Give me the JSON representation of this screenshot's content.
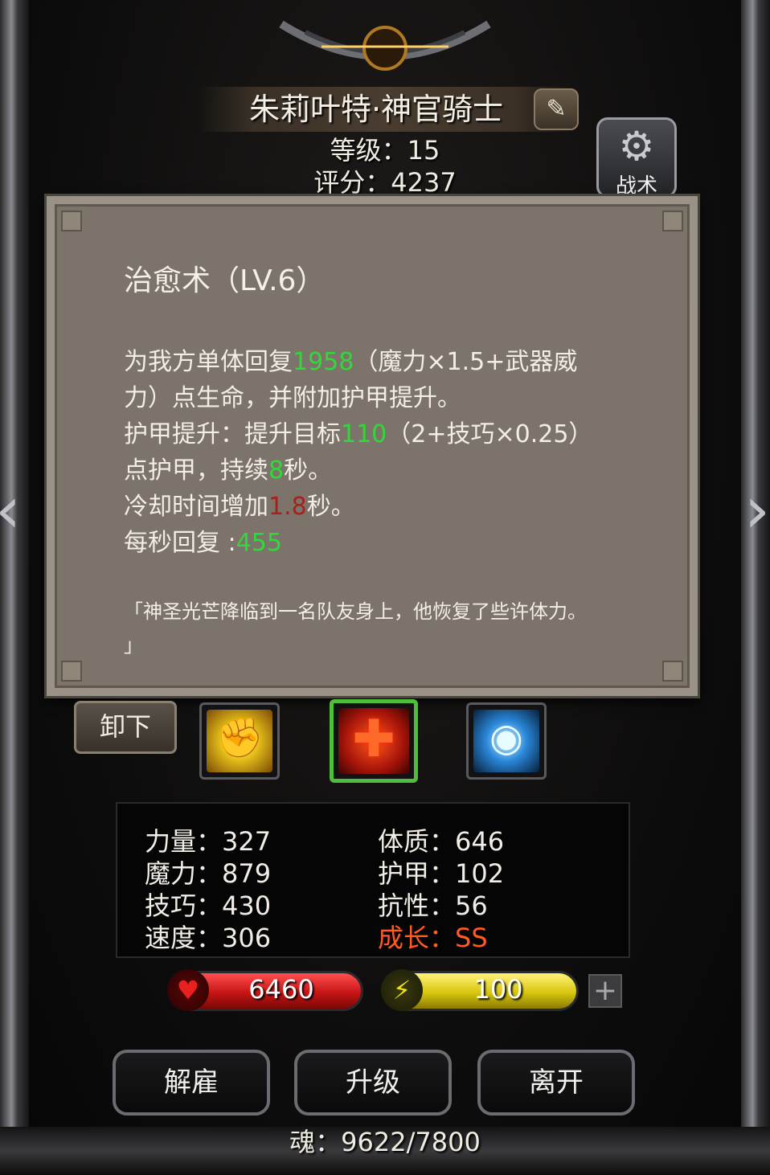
{
  "hero": {
    "name": "朱莉叶特·神官骑士",
    "level_text": "等级：15",
    "score_text": "评分：4237",
    "edit_icon": "edit-icon",
    "tactics_label": "战术",
    "tactics_icon": "gear-icon"
  },
  "tooltip": {
    "title": "治愈术（LV.6）",
    "line1_a": "为我方单体回复",
    "line1_val": "1958",
    "line1_b": "（魔力×1.5+武器威",
    "line2": "力）点生命，并附加护甲提升。",
    "line3_a": "护甲提升：提升目标",
    "line3_val": "110",
    "line3_b": "（2+技巧×0.25）",
    "line4_a": "点护甲，持续",
    "line4_val": "8",
    "line4_b": "秒。",
    "line5_a": "冷却时间增加",
    "line5_val": "1.8",
    "line5_b": "秒。",
    "line6_a": "每秒回复 :",
    "line6_val": "455",
    "quote_line1": "「神圣光芒降临到一名队友身上，他恢复了些许体力。",
    "quote_line2": "」",
    "colors": {
      "highlight": "#31d83a",
      "cooldown": "#a8201c"
    }
  },
  "skills": {
    "unequip_label": "卸下",
    "items": [
      {
        "icon": "fist-icon"
      },
      {
        "icon": "red-cross-icon",
        "selected": true
      },
      {
        "icon": "eye-icon"
      }
    ]
  },
  "stats": {
    "strength": "力量：327",
    "magic": "魔力：879",
    "skill": "技巧：430",
    "speed": "速度：306",
    "constitution": "体质：646",
    "armor": "护甲：102",
    "resistance": "抗性：56",
    "growth": "成长：SS",
    "growth_color": "#ff5a22"
  },
  "bars": {
    "hp": "6460",
    "energy": "100",
    "plus": "+"
  },
  "actions": {
    "dismiss": "解雇",
    "upgrade": "升级",
    "leave": "离开"
  },
  "soul_text": "魂：9622/7800"
}
